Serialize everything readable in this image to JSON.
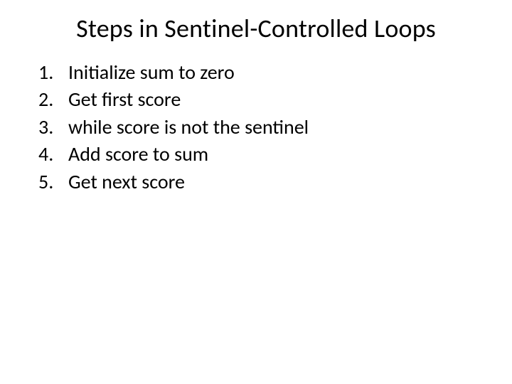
{
  "title": "Steps in Sentinel-Controlled Loops",
  "items": [
    {
      "num": "1.",
      "text": "Initialize sum to zero"
    },
    {
      "num": "2.",
      "text": "Get first score"
    },
    {
      "num": "3.",
      "text": "while score is not the sentinel"
    },
    {
      "num": "4.",
      "text": "Add score to sum"
    },
    {
      "num": "5.",
      "text": "Get next score"
    }
  ]
}
